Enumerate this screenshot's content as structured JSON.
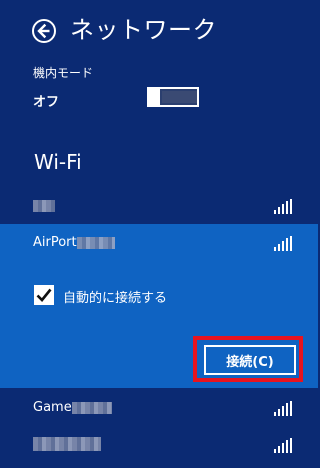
{
  "header": {
    "title": "ネットワーク",
    "back_icon": "back-arrow-icon"
  },
  "airplane_mode": {
    "label": "機内モード",
    "state": "オフ"
  },
  "wifi": {
    "heading": "Wi-Fi",
    "networks": [
      {
        "name": ""
      },
      {
        "name": "AirPort",
        "selected": true,
        "auto_connect_label": "自動的に接続する",
        "auto_connect_checked": true,
        "connect_label": "接続(C)"
      },
      {
        "name": "Game"
      },
      {
        "name": ""
      }
    ]
  },
  "colors": {
    "background": "#0b2a73",
    "selected_background": "#0f63c2",
    "highlight_outline": "#e8141f",
    "text": "#ffffff"
  }
}
